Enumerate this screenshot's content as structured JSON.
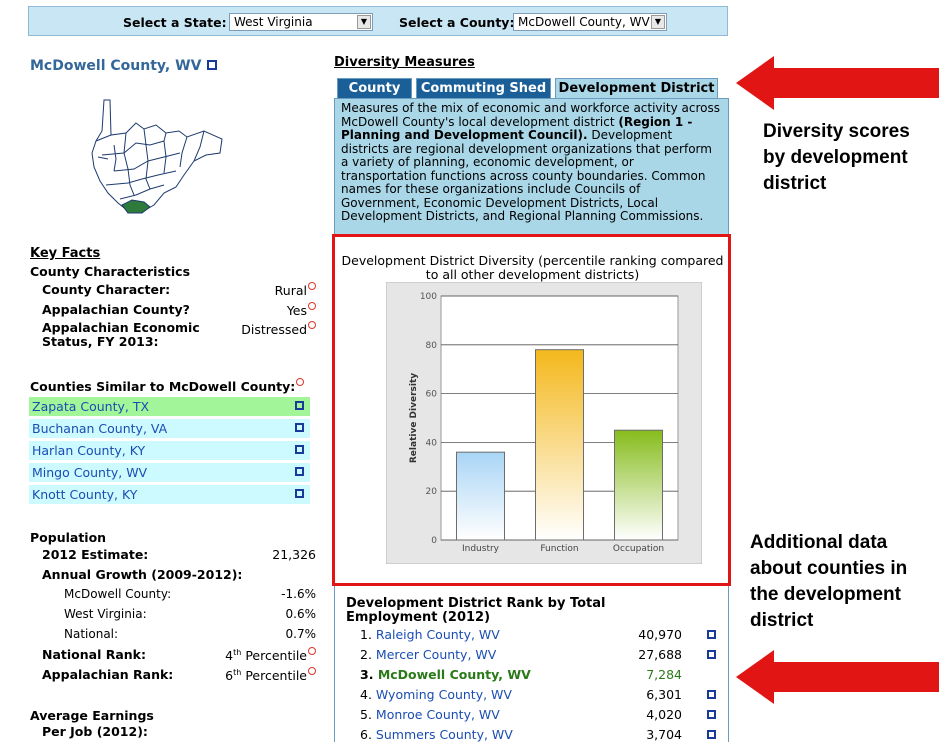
{
  "selectors": {
    "state_label": "Select a State:",
    "state_value": "West Virginia",
    "county_label": "Select a County:",
    "county_value": "McDowell County, WV"
  },
  "county": {
    "title": "McDowell County, WV"
  },
  "key_facts": {
    "heading": "Key Facts",
    "characteristics_heading": "County Characteristics",
    "rows": [
      {
        "label": "County Character:",
        "value": "Rural"
      },
      {
        "label": "Appalachian County?",
        "value": "Yes"
      },
      {
        "label": "Appalachian Economic Status, FY 2013:",
        "value": "Distressed"
      }
    ]
  },
  "similar": {
    "heading": "Counties Similar to McDowell County:",
    "items": [
      "Zapata County, TX",
      "Buchanan County, VA",
      "Harlan County, KY",
      "Mingo County, WV",
      "Knott County, KY"
    ]
  },
  "population": {
    "heading": "Population",
    "estimate_label": "2012 Estimate:",
    "estimate_value": "21,326",
    "growth_label": "Annual Growth (2009-2012):",
    "growth_rows": [
      {
        "label": "McDowell County:",
        "value": "-1.6%"
      },
      {
        "label": "West Virginia:",
        "value": "0.6%"
      },
      {
        "label": "National:",
        "value": "0.7%"
      }
    ],
    "national_rank_label": "National Rank:",
    "national_rank_num": "4",
    "national_rank_sup": "th",
    "national_rank_rest": " Percentile",
    "app_rank_label": "Appalachian Rank:",
    "app_rank_num": "6",
    "app_rank_sup": "th",
    "app_rank_rest": " Percentile"
  },
  "earnings": {
    "heading": "Average Earnings",
    "per_job_label": "Per Job (2012):"
  },
  "diversity": {
    "heading": "Diversity Measures",
    "tabs": [
      "County",
      "Commuting Shed",
      "Development District"
    ],
    "desc_1": "Measures of the mix of economic and workforce activity across McDowell County's local development district ",
    "desc_bold": "(Region 1 - Planning and Development Council).",
    "desc_2": " Development districts are regional development organizations that perform a variety of planning, economic development, or transportation functions across county boundaries. Common names for these organizations include Councils of Government, Economic Development Districts, Local Development Districts, and Regional Planning Commissions."
  },
  "chart_data": {
    "type": "bar",
    "title": "Development District Diversity (percentile ranking compared to all other development districts)",
    "ylabel": "Relative Diversity",
    "xlabel": "",
    "categories": [
      "Industry",
      "Function",
      "Occupation"
    ],
    "values": [
      36,
      78,
      45
    ],
    "ylim": [
      0,
      100
    ],
    "yticks": [
      0,
      20,
      40,
      60,
      80,
      100
    ],
    "grid": true,
    "colors": [
      "#a9d5f5",
      "#f4b81c",
      "#86bc1c"
    ]
  },
  "rank": {
    "heading": "Development District Rank by Total Employment (2012)",
    "items": [
      {
        "num": "1.",
        "name": "Raleigh County, WV",
        "value": "40,970",
        "current": false
      },
      {
        "num": "2.",
        "name": "Mercer County, WV",
        "value": "27,688",
        "current": false
      },
      {
        "num": "3.",
        "name": "McDowell County, WV",
        "value": "7,284",
        "current": true
      },
      {
        "num": "4.",
        "name": "Wyoming County, WV",
        "value": "6,301",
        "current": false
      },
      {
        "num": "5.",
        "name": "Monroe County, WV",
        "value": "4,020",
        "current": false
      },
      {
        "num": "6.",
        "name": "Summers County, WV",
        "value": "3,704",
        "current": false
      }
    ]
  },
  "annotations": {
    "top": [
      "Diversity scores",
      "by development",
      "district"
    ],
    "bottom": [
      "Additional data",
      "about counties in",
      "the development",
      "district"
    ]
  },
  "colors": {
    "topbar": "#c9e6f5",
    "tab_dark": "#1b5f99",
    "tab_active": "#a9d7e8",
    "highlight_green": "#a3f59a",
    "similar_bg": "#ccfaff",
    "link": "#1a4db3",
    "arrow_red": "#e21515"
  }
}
